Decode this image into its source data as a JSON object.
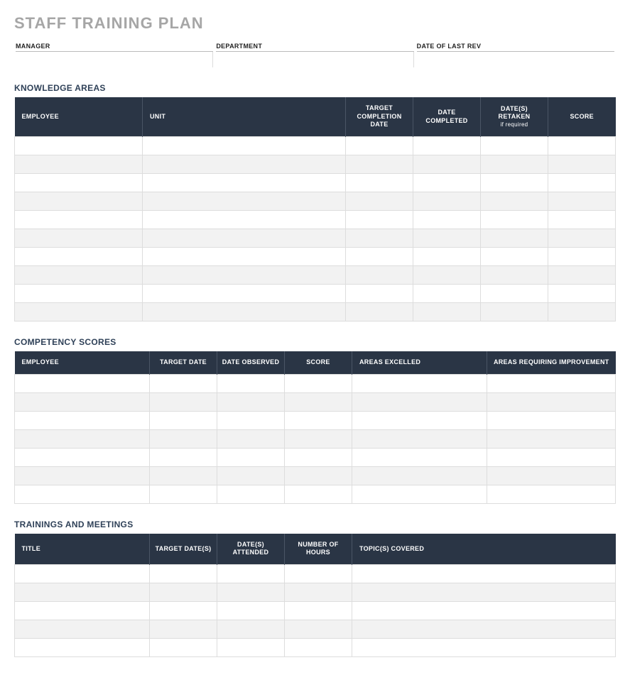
{
  "title": "STAFF TRAINING PLAN",
  "meta": {
    "manager_label": "MANAGER",
    "manager_value": "",
    "department_label": "DEPARTMENT",
    "department_value": "",
    "lastrev_label": "DATE OF LAST REV",
    "lastrev_value": ""
  },
  "knowledge_areas": {
    "section_title": "KNOWLEDGE AREAS",
    "headers": {
      "employee": "EMPLOYEE",
      "unit": "UNIT",
      "target_completion": "TARGET COMPLETION DATE",
      "date_completed": "DATE COMPLETED",
      "dates_retaken": "DATE(S) RETAKEN",
      "dates_retaken_sub": "if required",
      "score": "SCORE"
    },
    "rows": [
      {
        "employee": "",
        "unit": "",
        "target_completion": "",
        "date_completed": "",
        "dates_retaken": "",
        "score": ""
      },
      {
        "employee": "",
        "unit": "",
        "target_completion": "",
        "date_completed": "",
        "dates_retaken": "",
        "score": ""
      },
      {
        "employee": "",
        "unit": "",
        "target_completion": "",
        "date_completed": "",
        "dates_retaken": "",
        "score": ""
      },
      {
        "employee": "",
        "unit": "",
        "target_completion": "",
        "date_completed": "",
        "dates_retaken": "",
        "score": ""
      },
      {
        "employee": "",
        "unit": "",
        "target_completion": "",
        "date_completed": "",
        "dates_retaken": "",
        "score": ""
      },
      {
        "employee": "",
        "unit": "",
        "target_completion": "",
        "date_completed": "",
        "dates_retaken": "",
        "score": ""
      },
      {
        "employee": "",
        "unit": "",
        "target_completion": "",
        "date_completed": "",
        "dates_retaken": "",
        "score": ""
      },
      {
        "employee": "",
        "unit": "",
        "target_completion": "",
        "date_completed": "",
        "dates_retaken": "",
        "score": ""
      },
      {
        "employee": "",
        "unit": "",
        "target_completion": "",
        "date_completed": "",
        "dates_retaken": "",
        "score": ""
      },
      {
        "employee": "",
        "unit": "",
        "target_completion": "",
        "date_completed": "",
        "dates_retaken": "",
        "score": ""
      }
    ]
  },
  "competency_scores": {
    "section_title": "COMPETENCY SCORES",
    "headers": {
      "employee": "EMPLOYEE",
      "target_date": "TARGET DATE",
      "date_observed": "DATE OBSERVED",
      "score": "SCORE",
      "areas_excelled": "AREAS EXCELLED",
      "areas_improvement": "AREAS REQUIRING IMPROVEMENT"
    },
    "rows": [
      {
        "employee": "",
        "target_date": "",
        "date_observed": "",
        "score": "",
        "areas_excelled": "",
        "areas_improvement": ""
      },
      {
        "employee": "",
        "target_date": "",
        "date_observed": "",
        "score": "",
        "areas_excelled": "",
        "areas_improvement": ""
      },
      {
        "employee": "",
        "target_date": "",
        "date_observed": "",
        "score": "",
        "areas_excelled": "",
        "areas_improvement": ""
      },
      {
        "employee": "",
        "target_date": "",
        "date_observed": "",
        "score": "",
        "areas_excelled": "",
        "areas_improvement": ""
      },
      {
        "employee": "",
        "target_date": "",
        "date_observed": "",
        "score": "",
        "areas_excelled": "",
        "areas_improvement": ""
      },
      {
        "employee": "",
        "target_date": "",
        "date_observed": "",
        "score": "",
        "areas_excelled": "",
        "areas_improvement": ""
      },
      {
        "employee": "",
        "target_date": "",
        "date_observed": "",
        "score": "",
        "areas_excelled": "",
        "areas_improvement": ""
      }
    ]
  },
  "trainings_meetings": {
    "section_title": "TRAININGS AND MEETINGS",
    "headers": {
      "title": "TITLE",
      "target_dates": "TARGET DATE(S)",
      "dates_attended": "DATE(S) ATTENDED",
      "number_of_hours": "NUMBER OF HOURS",
      "topics_covered": "TOPIC(S) COVERED"
    },
    "rows": [
      {
        "title": "",
        "target_dates": "",
        "dates_attended": "",
        "number_of_hours": "",
        "topics_covered": ""
      },
      {
        "title": "",
        "target_dates": "",
        "dates_attended": "",
        "number_of_hours": "",
        "topics_covered": ""
      },
      {
        "title": "",
        "target_dates": "",
        "dates_attended": "",
        "number_of_hours": "",
        "topics_covered": ""
      },
      {
        "title": "",
        "target_dates": "",
        "dates_attended": "",
        "number_of_hours": "",
        "topics_covered": ""
      },
      {
        "title": "",
        "target_dates": "",
        "dates_attended": "",
        "number_of_hours": "",
        "topics_covered": ""
      }
    ]
  }
}
